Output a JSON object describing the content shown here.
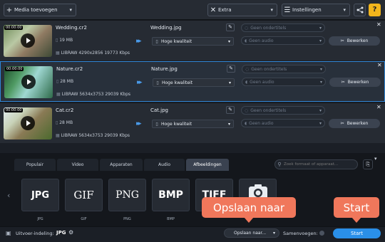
{
  "toolbar": {
    "add_media_label": "Media toevoegen",
    "extra_label": "Extra",
    "settings_label": "Instellingen",
    "help_label": "?"
  },
  "files": [
    {
      "time": "00:00:00",
      "name": "Wedding.cr2",
      "size": "19 MB",
      "info": "LIBRAW 4290x2856 19773 Kbps",
      "output": "Wedding.jpg",
      "quality": "Hoge kwaliteit",
      "subtitles": "Geen ondertitels",
      "audio": "Geen audio",
      "edit": "Bewerken"
    },
    {
      "time": "00:00:00",
      "name": "Nature.cr2",
      "size": "28 MB",
      "info": "LIBRAW 5634x3753 29039 Kbps",
      "output": "Nature.jpg",
      "quality": "Hoge kwaliteit",
      "subtitles": "Geen ondertitels",
      "audio": "Geen audio",
      "edit": "Bewerken"
    },
    {
      "time": "00:00:00",
      "name": "Cat.cr2",
      "size": "28 MB",
      "info": "LIBRAW 5634x3753 29039 Kbps",
      "output": "Cat.jpg",
      "quality": "Hoge kwaliteit",
      "subtitles": "Geen ondertitels",
      "audio": "Geen audio",
      "edit": "Bewerken"
    }
  ],
  "tabs": [
    "Populair",
    "Video",
    "Apparaten",
    "Audio",
    "Afbeeldingen"
  ],
  "active_tab": "Afbeeldingen",
  "search_placeholder": "Zoek formaat of apparaat...",
  "formats": [
    {
      "icon_text": "JPG",
      "label": "JPG"
    },
    {
      "icon_text": "GIF",
      "label": "GIF"
    },
    {
      "icon_text": "PNG",
      "label": "PNG"
    },
    {
      "icon_text": "BMP",
      "label": "BMP"
    },
    {
      "icon_text": "TIFF",
      "label": ""
    },
    {
      "icon_text": "",
      "label": ""
    }
  ],
  "footer": {
    "output_label": "Uitvoer-indeling:",
    "output_value": "JPG",
    "save_to_label": "Opslaan naar...",
    "merge_label": "Samenvoegen:",
    "start_label": "Start"
  },
  "callouts": {
    "save_to": "Opslaan naar",
    "start": "Start"
  },
  "colors": {
    "accent": "#2f86d6",
    "callout": "#f0775b",
    "start": "#2a8fe8"
  }
}
